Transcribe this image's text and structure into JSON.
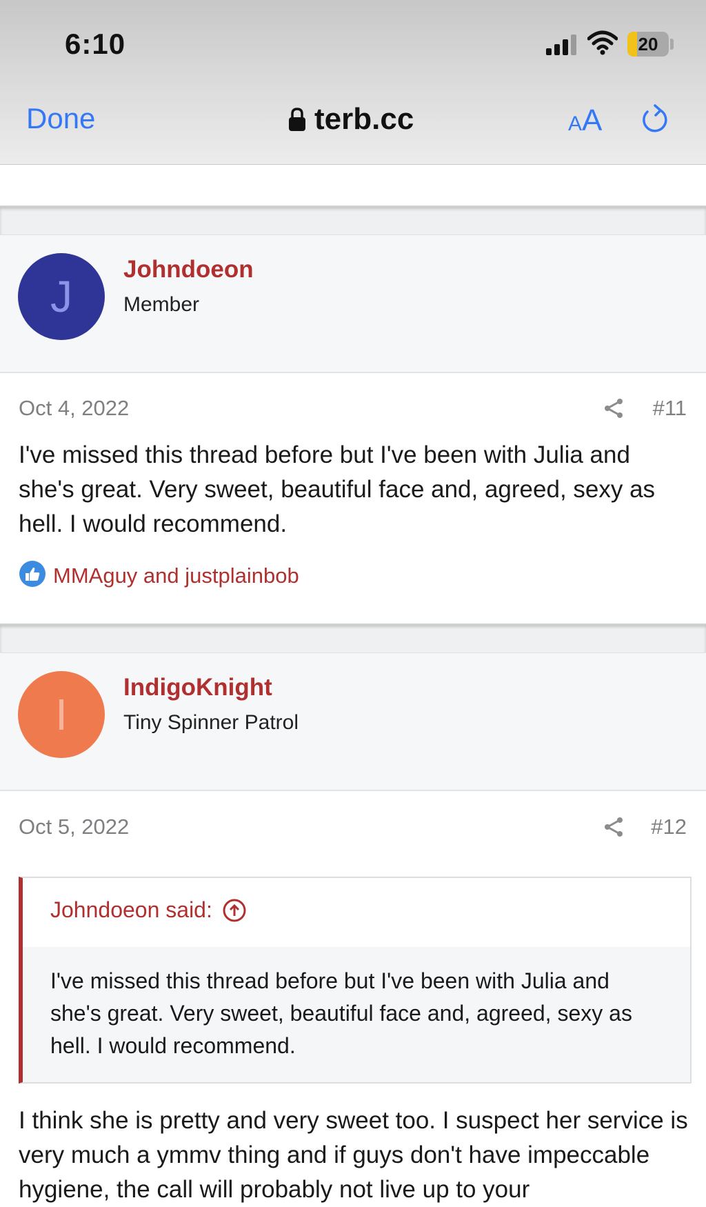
{
  "status_bar": {
    "time": "6:10",
    "battery": "20",
    "icons": [
      "cellular-signal-icon",
      "wifi-icon",
      "battery-icon"
    ]
  },
  "browser": {
    "done_label": "Done",
    "url": "terb.cc",
    "text_size_small": "A",
    "text_size_large": "A",
    "icons": [
      "lock-icon",
      "reload-icon"
    ],
    "accent": "#3478f6"
  },
  "posts": [
    {
      "author": "Johndoeon",
      "author_title": "Member",
      "avatar_letter": "J",
      "avatar_bg": "#2f3596",
      "avatar_fg": "#8a94e8",
      "date": "Oct 4, 2022",
      "number": "#11",
      "text": "I've missed this thread before but I've been with Julia and she's great. Very sweet, beautiful face and, agreed, sexy as hell. I would recommend.",
      "reactions": "MMAguy and justplainbob"
    },
    {
      "author": "IndigoKnight",
      "author_title": "Tiny Spinner Patrol",
      "avatar_letter": "I",
      "avatar_bg": "#ee7a4e",
      "avatar_fg": "#f6b39a",
      "date": "Oct 5, 2022",
      "number": "#12",
      "quote_author": "Johndoeon said:",
      "quote_text": "I've missed this thread before but I've been with Julia and she's great. Very sweet, beautiful face and, agreed, sexy as hell. I would recommend.",
      "text": "I think she is pretty and very sweet too. I suspect her service is very much a ymmv thing and if guys don't have impeccable hygiene, the call will probably not live up to your"
    }
  ],
  "colors": {
    "link_red": "#b03030",
    "meta_gray": "#7d7f82"
  }
}
